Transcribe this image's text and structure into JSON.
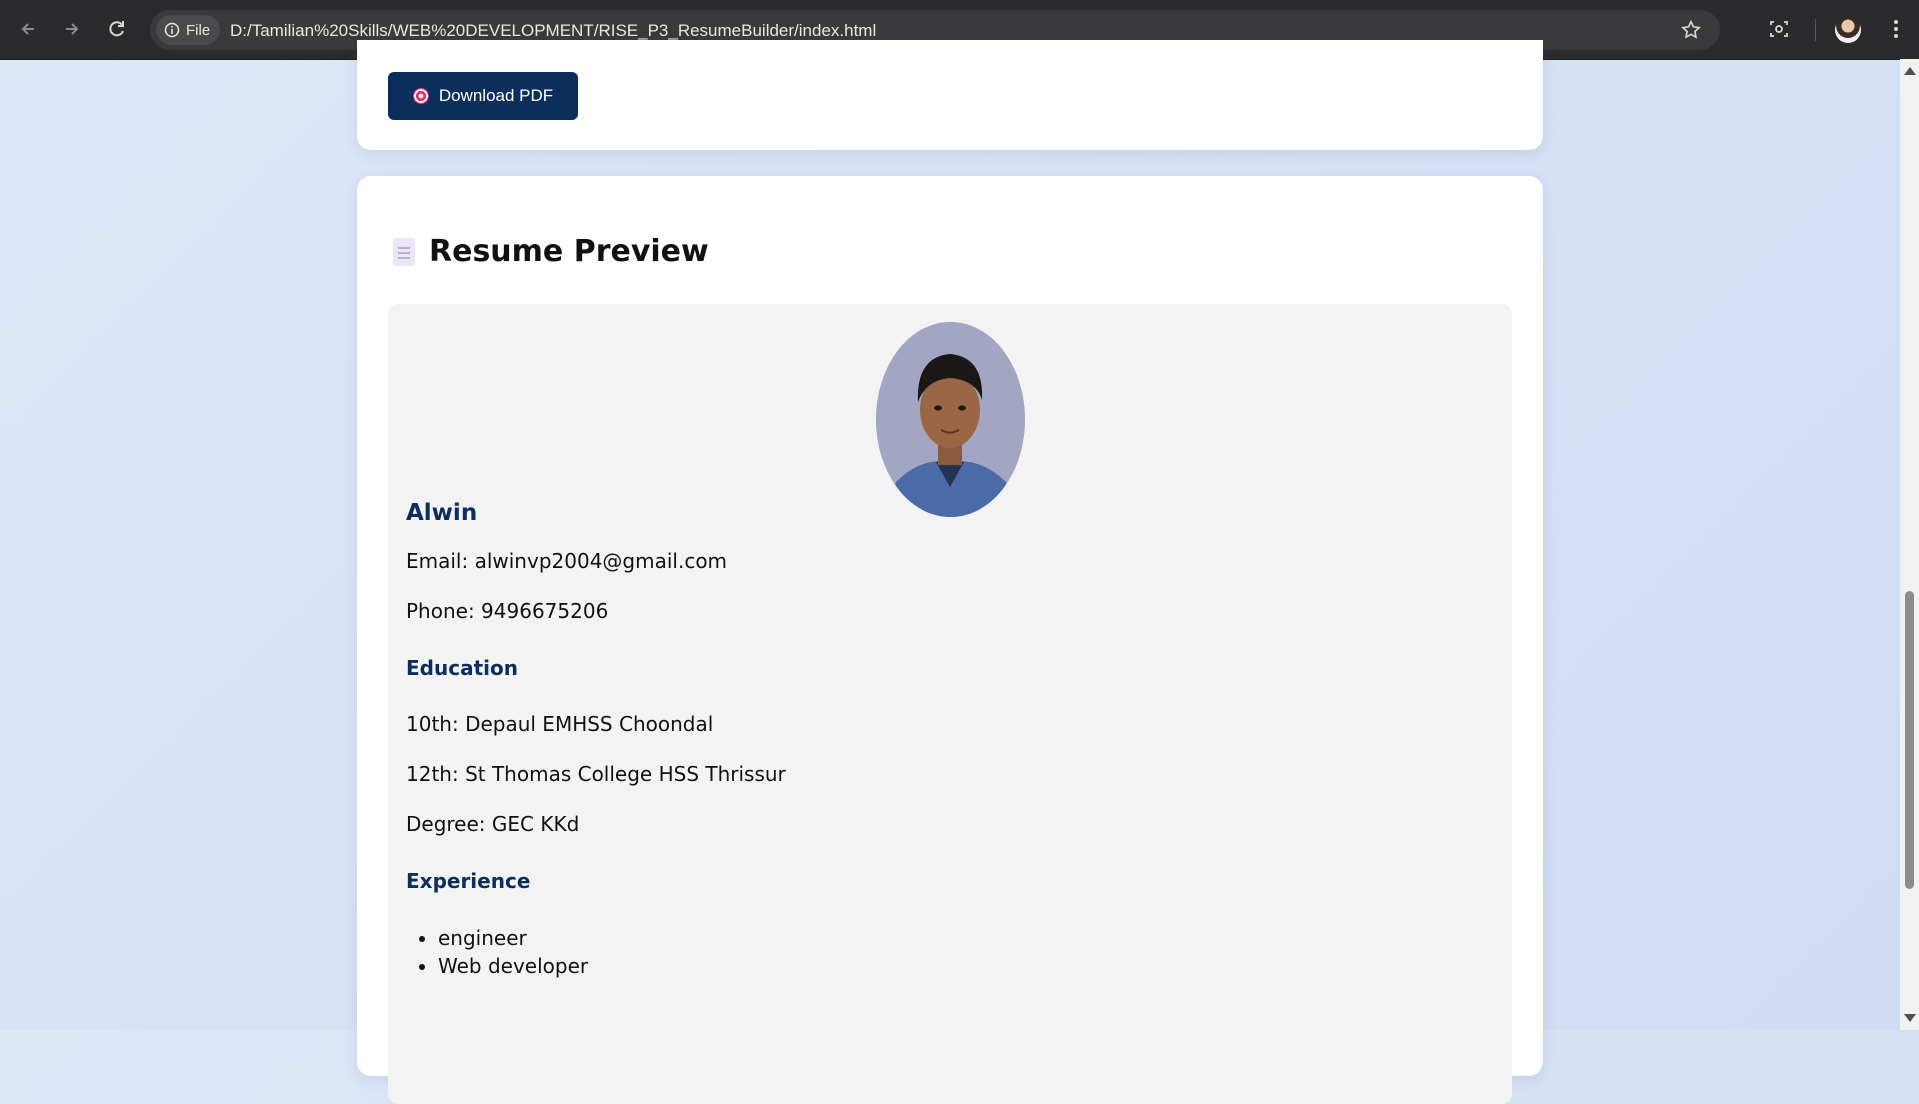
{
  "browser": {
    "chip_label": "File",
    "url": "D:/Tamilian%20Skills/WEB%20DEVELOPMENT/RISE_P3_ResumeBuilder/index.html"
  },
  "toolbar": {
    "download_label": "Download PDF"
  },
  "preview": {
    "title": "Resume Preview",
    "name": "Alwin",
    "email": "Email: alwinvp2004@gmail.com",
    "phone": "Phone: 9496675206",
    "education_heading": "Education",
    "education": [
      "10th: Depaul EMHSS Choondal",
      "12th: St Thomas College HSS Thrissur",
      "Degree: GEC KKd"
    ],
    "experience_heading": "Experience",
    "experience": [
      "engineer",
      "Web developer"
    ]
  },
  "colors": {
    "accent": "#0b2e5c",
    "page_bg": "#d6e2f6",
    "resume_bg": "#f3f3f3"
  }
}
